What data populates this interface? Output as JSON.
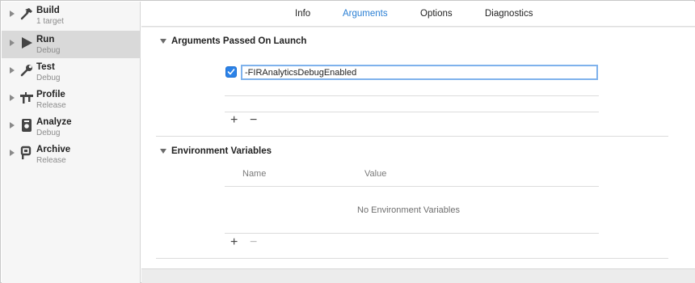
{
  "sidebar": {
    "items": [
      {
        "title": "Build",
        "subtitle": "1 target",
        "icon": "hammer-icon",
        "selected": false
      },
      {
        "title": "Run",
        "subtitle": "Debug",
        "icon": "play-icon",
        "selected": true
      },
      {
        "title": "Test",
        "subtitle": "Debug",
        "icon": "wrench-icon",
        "selected": false
      },
      {
        "title": "Profile",
        "subtitle": "Release",
        "icon": "caliper-icon",
        "selected": false
      },
      {
        "title": "Analyze",
        "subtitle": "Debug",
        "icon": "analyze-icon",
        "selected": false
      },
      {
        "title": "Archive",
        "subtitle": "Release",
        "icon": "archive-icon",
        "selected": false
      }
    ]
  },
  "tabs": [
    {
      "label": "Info",
      "active": false
    },
    {
      "label": "Arguments",
      "active": true
    },
    {
      "label": "Options",
      "active": false
    },
    {
      "label": "Diagnostics",
      "active": false
    }
  ],
  "arguments_section": {
    "title": "Arguments Passed On Launch",
    "arguments": [
      {
        "value": "-FIRAnalyticsDebugEnabled",
        "enabled": true
      }
    ],
    "add_label": "+",
    "remove_label": "−"
  },
  "environment_section": {
    "title": "Environment Variables",
    "columns": {
      "name": "Name",
      "value": "Value"
    },
    "empty_text": "No Environment Variables",
    "add_label": "+",
    "remove_label": "−"
  },
  "colors": {
    "accent": "#2a7fd4",
    "checkbox": "#2b82e8",
    "selected_row": "#d9d9d9"
  }
}
